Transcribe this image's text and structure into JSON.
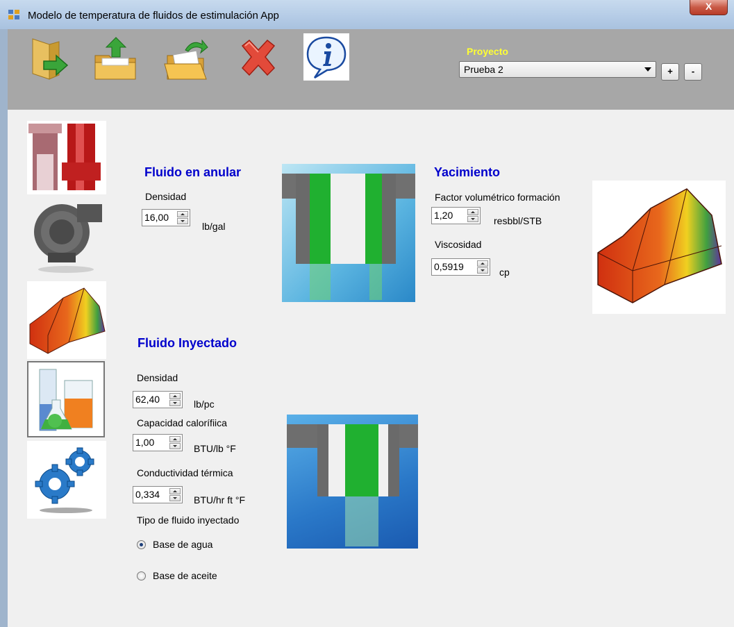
{
  "window": {
    "title": "Modelo de temperatura de fluidos de estimulación App",
    "close_label": "X"
  },
  "toolbar": {
    "buttons": [
      "enter-icon",
      "upload-folder-icon",
      "open-folder-icon",
      "delete-icon",
      "info-icon"
    ],
    "project_label": "Proyecto",
    "project_value": "Prueba 2",
    "add_label": "+",
    "remove_label": "-"
  },
  "annulus": {
    "title": "Fluido en anular",
    "density_label": "Densidad",
    "density_value": "16,00",
    "density_unit": "lb/gal"
  },
  "reservoir": {
    "title": "Yacimiento",
    "fvf_label": "Factor volumétrico formación",
    "fvf_value": "1,20",
    "fvf_unit": "resbbl/STB",
    "viscosity_label": "Viscosidad",
    "viscosity_value": "0,5919",
    "viscosity_unit": "cp"
  },
  "injected": {
    "title": "Fluido Inyectado",
    "density_label": "Densidad",
    "density_value": "62,40",
    "density_unit": "lb/pc",
    "heat_capacity_label": "Capacidad calorífiica",
    "heat_capacity_value": "1,00",
    "heat_capacity_unit": "BTU/lb °F",
    "conductivity_label": "Conductividad térmica",
    "conductivity_value": "0,334",
    "conductivity_unit": "BTU/hr ft °F",
    "fluid_type_label": "Tipo de fluido inyectado",
    "option_water": "Base de agua",
    "option_oil": "Base de aceite",
    "selected": "Base de agua"
  },
  "colors": {
    "heading": "#0000cc",
    "project_label": "#ffff33",
    "toolbar_bg": "#a7a7a7",
    "panel_bg": "#f0f0f0"
  }
}
